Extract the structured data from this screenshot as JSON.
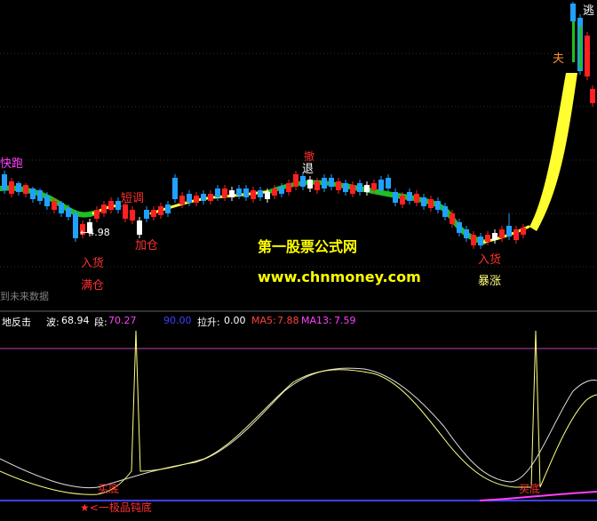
{
  "main_labels": {
    "kuaipao": "快跑",
    "duantiao": "短调",
    "tui_top": "撤",
    "tui": "退",
    "jiacang": "加仓",
    "price": "←4.98",
    "ruhuo_left": "入货",
    "mancang": "满仓",
    "ruhuo_right": "入货",
    "baozhang": "暴涨",
    "future_data": "到未来数据",
    "escape_top": "逃",
    "escape_side": "夫"
  },
  "watermark": {
    "title": "第一股票公式网",
    "url": "www.chnmoney.com"
  },
  "indicator": {
    "name": "地反击",
    "bo_label": "波:",
    "bo_value": "68.94",
    "duan_label": "段:",
    "duan_value": "70.27",
    "blue_value": "90.00",
    "lasheng_label": "拉升:",
    "lasheng_value": "0.00",
    "ma5_label": "MA5:",
    "ma5_value": "7.88",
    "ma13_label": "MA13:",
    "ma13_value": "7.59"
  },
  "lower_labels": {
    "maidi_left": "买底",
    "jidi": "★<一极品钝底",
    "maidi_right": "买底"
  },
  "colors": {
    "background": "#000000",
    "up_candle": "#ff2020",
    "down_candle": "#20a0ff",
    "flat_candle": "#ffffff",
    "trend_green": "#20c020",
    "trend_yellow": "#ffff40",
    "signal_red": "#ff3030",
    "signal_magenta": "#ff40ff",
    "line_yellow": "#ffff80",
    "line_white": "#e0e0e0",
    "ref_magenta": "#c040c0",
    "watermark_yellow": "#ffff00",
    "blue_value": "#4040ff"
  }
}
